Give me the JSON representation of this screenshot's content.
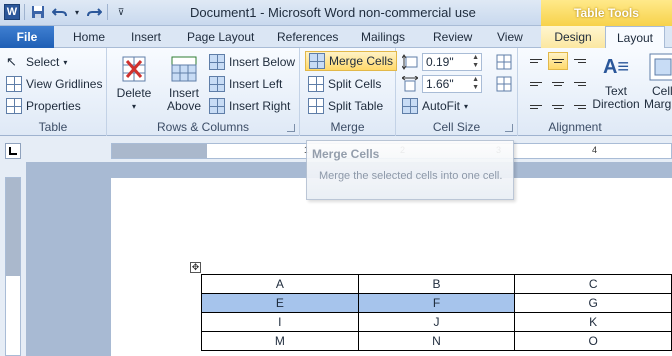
{
  "window": {
    "title": "Document1  -  Microsoft Word non-commercial use",
    "contextual_title": "Table Tools"
  },
  "quick_access": {
    "app_icon": "word-icon",
    "items": [
      "save-icon",
      "undo-icon",
      "redo-icon",
      "customize-icon"
    ]
  },
  "tabs": [
    "File",
    "Home",
    "Insert",
    "Page Layout",
    "References",
    "Mailings",
    "Review",
    "View",
    "Design",
    "Layout"
  ],
  "active_tab": "Layout",
  "ribbon": {
    "table": {
      "label": "Table",
      "select": "Select",
      "view_gridlines": "View Gridlines",
      "properties": "Properties"
    },
    "rows_columns": {
      "label": "Rows & Columns",
      "delete": "Delete",
      "insert_above_1": "Insert",
      "insert_above_2": "Above",
      "insert_below": "Insert Below",
      "insert_left": "Insert Left",
      "insert_right": "Insert Right"
    },
    "merge": {
      "label": "Merge",
      "merge_cells": "Merge Cells",
      "split_cells": "Split Cells",
      "split_table": "Split Table"
    },
    "cell_size": {
      "label": "Cell Size",
      "height": "0.19\"",
      "width": "1.66\"",
      "autofit": "AutoFit"
    },
    "alignment": {
      "label": "Alignment",
      "text_direction_1": "Text",
      "text_direction_2": "Direction",
      "cell_margins_1": "Cell",
      "cell_margins_2": "Margins"
    }
  },
  "ruler": {
    "numbers": [
      "1",
      "2",
      "3",
      "4"
    ]
  },
  "tooltip": {
    "title": "Merge Cells",
    "body": "Merge the selected cells into one cell."
  },
  "table": {
    "rows": [
      [
        "A",
        "B",
        "C"
      ],
      [
        "E",
        "F",
        "G"
      ],
      [
        "I",
        "J",
        "K"
      ],
      [
        "M",
        "N",
        "O"
      ]
    ],
    "selected_cells": [
      "E",
      "F"
    ]
  },
  "colors": {
    "accent": "#2b579a",
    "selection": "#a6c4ec",
    "contextual": "#f7d24b"
  }
}
